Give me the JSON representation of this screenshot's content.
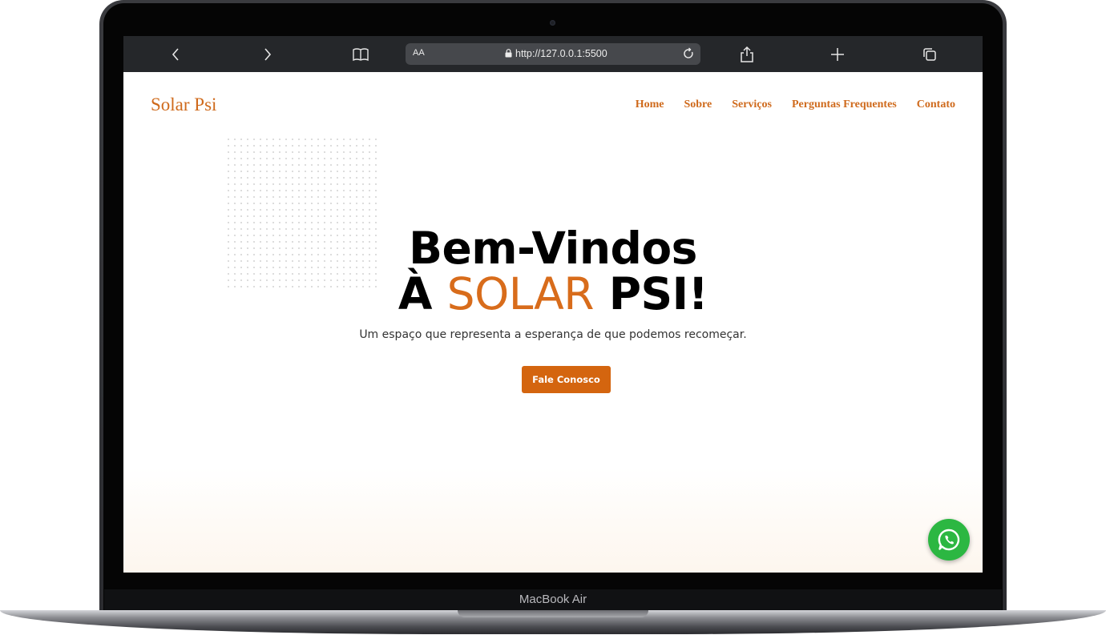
{
  "device": {
    "model_label": "MacBook Air"
  },
  "browser": {
    "aa_label": "AA",
    "url": "http://127.0.0.1:5500",
    "icons": [
      "chevron-left-icon",
      "chevron-right-icon",
      "book-icon",
      "lock-icon",
      "reload-icon",
      "share-icon",
      "plus-icon",
      "tabs-icon"
    ]
  },
  "site": {
    "logo": "Solar Psi",
    "nav": [
      "Home",
      "Sobre",
      "Serviços",
      "Perguntas Frequentes",
      "Contato"
    ],
    "hero": {
      "line1": "Bem-Vindos",
      "line2_prefix": "À",
      "line2_accent": "SOLAR",
      "line2_suffix": "PSI!",
      "subtitle": "Um espaço que representa a esperança de que podemos recomeçar.",
      "cta_label": "Fale Conosco"
    },
    "floating_icon": "whatsapp-icon"
  },
  "colors": {
    "accent": "#cf6a1c",
    "button": "#d4650f",
    "whatsapp": "#2cb742",
    "toolbar": "#25272a"
  }
}
